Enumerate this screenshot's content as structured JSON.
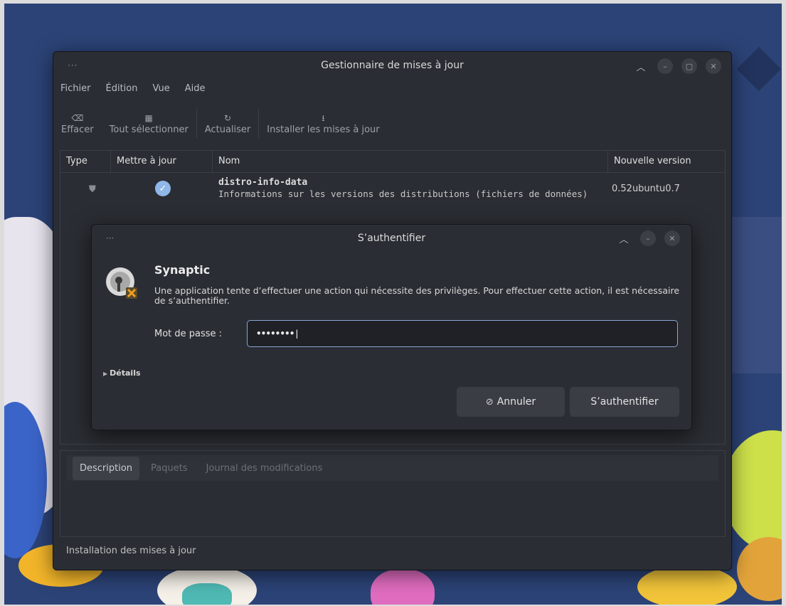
{
  "main_window": {
    "title": "Gestionnaire de mises à jour",
    "menus": [
      "Fichier",
      "Édition",
      "Vue",
      "Aide"
    ],
    "toolbar": [
      {
        "label": "Effacer",
        "icon": "clear-icon"
      },
      {
        "label": "Tout sélectionner",
        "icon": "select-all-icon"
      },
      {
        "label": "Actualiser",
        "icon": "refresh-icon"
      },
      {
        "label": "Installer les mises à jour",
        "icon": "download-icon"
      }
    ],
    "columns": [
      "Type",
      "Mettre à jour",
      "Nom",
      "Nouvelle version"
    ],
    "packages": [
      {
        "name": "distro-info-data",
        "description": "Informations sur les versions des distributions (fichiers de données)",
        "version": "0.52ubuntu0.7",
        "selected": true
      }
    ],
    "tabs": [
      "Description",
      "Paquets",
      "Journal des modifications"
    ],
    "active_tab": "Description",
    "status": "Installation des mises à jour"
  },
  "auth_dialog": {
    "title": "S’authentifier",
    "app_name": "Synaptic",
    "message": "Une application tente d’effectuer une action qui nécessite des privilèges. Pour effectuer cette action, il est nécessaire de s’authentifier.",
    "password_label": "Mot de passe :",
    "password_value": "••••••••",
    "details_label": "Détails",
    "cancel_label": "Annuler",
    "ok_label": "S’authentifier"
  },
  "colors": {
    "window_bg": "#2a2d33",
    "accent": "#8aa6d6",
    "wallpaper": "#2c4377"
  }
}
